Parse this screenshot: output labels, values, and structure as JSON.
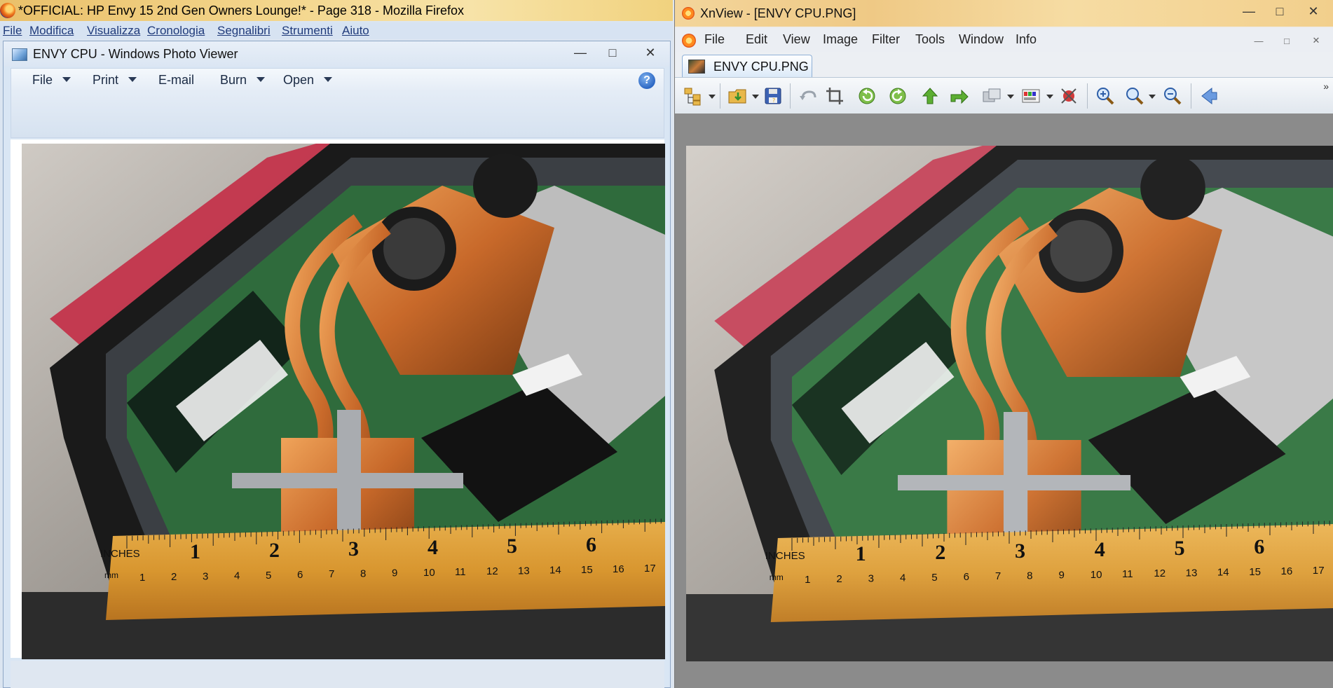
{
  "firefox": {
    "title": "*OFFICIAL: HP Envy 15 2nd Gen Owners Lounge!* - Page 318 - Mozilla Firefox",
    "menu": [
      "File",
      "Modifica",
      "Visualizza",
      "Cronologia",
      "Segnalibri",
      "Strumenti",
      "Aiuto"
    ]
  },
  "photo_viewer": {
    "title": "ENVY CPU - Windows Photo Viewer",
    "toolbar": {
      "file": "File",
      "print": "Print",
      "email": "E-mail",
      "burn": "Burn",
      "open": "Open"
    },
    "help_glyph": "?"
  },
  "xnview": {
    "title": "XnView - [ENVY CPU.PNG]",
    "menu": [
      "File",
      "Edit",
      "View",
      "Image",
      "Filter",
      "Tools",
      "Window",
      "Info"
    ],
    "tab_label": "ENVY CPU.PNG"
  },
  "window_controls": {
    "minimize": "—",
    "maximize": "□",
    "close": "✕"
  },
  "photo": {
    "ruler_unit_top": "INCHES",
    "ruler_unit_bottom": "mm",
    "inches": [
      "1",
      "2",
      "3",
      "4",
      "5",
      "6"
    ],
    "cm": [
      "1",
      "2",
      "3",
      "4",
      "5",
      "6",
      "7",
      "8",
      "9",
      "10",
      "11",
      "12",
      "13",
      "14",
      "15",
      "16",
      "17"
    ]
  },
  "colors": {
    "wpv_chrome": "#d9e6f4",
    "xnview_canvas": "#8b8b8b",
    "copper": "#c8692a",
    "pcb_green": "#2f6b3c",
    "ruler": "#e0a23a"
  }
}
